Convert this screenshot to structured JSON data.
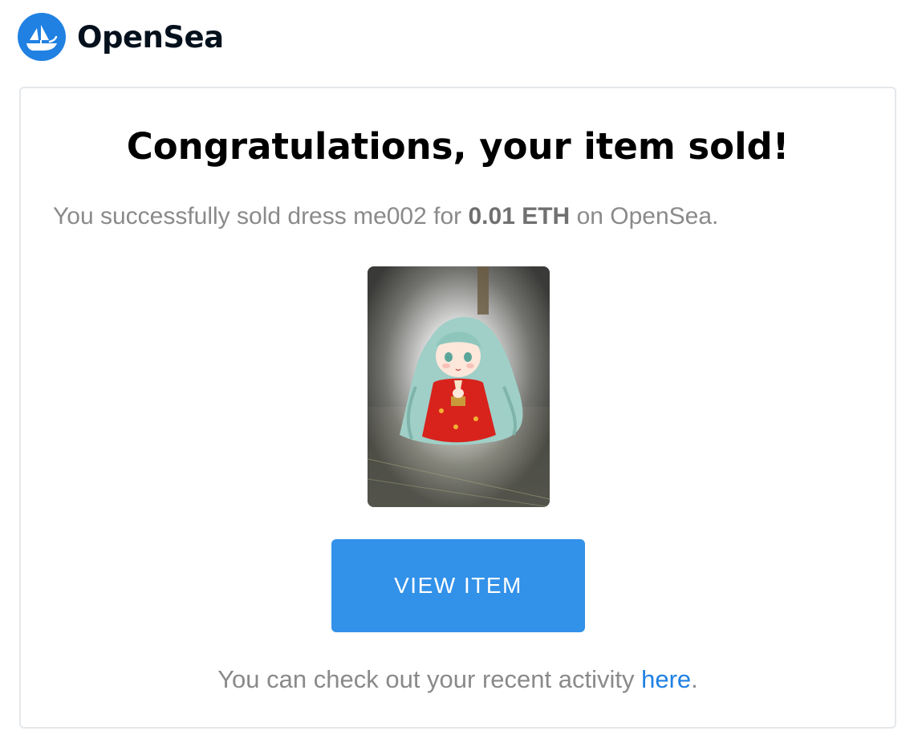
{
  "brand": {
    "name": "OpenSea",
    "color": "#2081e2"
  },
  "card": {
    "title": "Congratulations, your item sold!",
    "message": {
      "prefix": "You successfully sold dress me002 for ",
      "price": "0.01 ETH",
      "suffix": " on OpenSea."
    },
    "item_image": "anime girl with long teal hair in red kimono sitting on tatami",
    "button_label": "VIEW ITEM",
    "button_color": "#3291e9",
    "footer": {
      "prefix": "You can check out your recent activity ",
      "link": "here",
      "suffix": "."
    }
  }
}
